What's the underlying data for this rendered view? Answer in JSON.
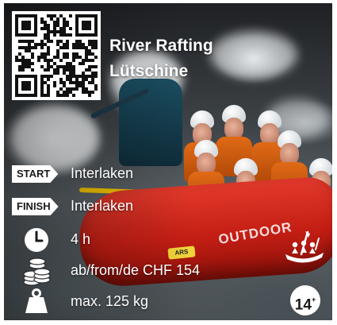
{
  "title": {
    "line1": "River Rafting",
    "line2": "Lütschine"
  },
  "start": {
    "tag": "START",
    "value": "Interlaken"
  },
  "finish": {
    "tag": "FINISH",
    "value": "Interlaken"
  },
  "duration": "4 h",
  "price": "ab/from/de CHF 154",
  "weight": "max. 125 kg",
  "age": {
    "number": "14",
    "suffix": "+"
  },
  "raft_branding": {
    "brand": "OUTDOOR",
    "logo": "ARS"
  },
  "icons": {
    "qr": "qr-code",
    "duration": "clock-icon",
    "price": "coins-icon",
    "weight": "weight-icon",
    "activity": "raft-icon"
  },
  "colors": {
    "raft": "#c41e14",
    "vest": "#e06a16",
    "overlay_text": "#ffffff"
  }
}
